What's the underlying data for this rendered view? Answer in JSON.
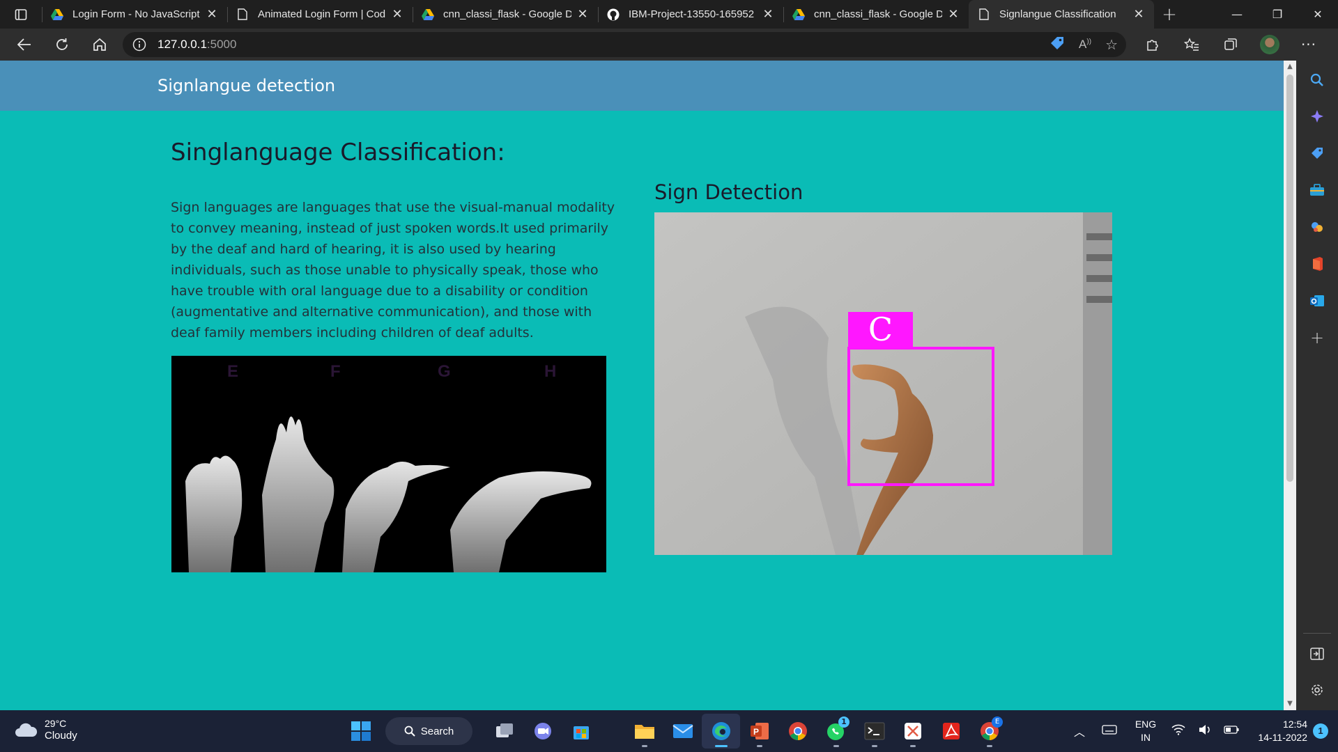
{
  "browser": {
    "tabs": [
      {
        "title": "Login Form - No JavaScript",
        "icon": "drive-icon"
      },
      {
        "title": "Animated Login Form | Cod",
        "icon": "page-icon"
      },
      {
        "title": "cnn_classi_flask - Google Dr",
        "icon": "drive-icon"
      },
      {
        "title": "IBM-Project-13550-165952",
        "icon": "github-icon"
      },
      {
        "title": "cnn_classi_flask - Google Dr",
        "icon": "drive-icon"
      },
      {
        "title": "Signlangue Classification",
        "icon": "page-icon",
        "active": true
      }
    ],
    "address": {
      "host": "127.0.0.1",
      "port": ":5000"
    }
  },
  "page": {
    "brand": "Signlangue detection",
    "heading": "Singlanguage Classification:",
    "description": "Sign languages are languages that use the visual-manual modality to convey meaning, instead of just spoken words.It used primarily by the deaf and hard of hearing, it is also used by hearing individuals, such as those unable to physically speak, those who have trouble with oral language due to a disability or condition (augmentative and alternative communication), and those with deaf family members including children of deaf adults.",
    "image_letters": [
      "E",
      "F",
      "G",
      "H"
    ],
    "detection_title": "Sign Detection",
    "prediction_label": "C",
    "accent_color": "#ff17ff",
    "background_color": "#0abcb6",
    "navbar_color": "#4a90b9"
  },
  "taskbar": {
    "weather_temp": "29°C",
    "weather_desc": "Cloudy",
    "search_label": "Search",
    "lang_top": "ENG",
    "lang_bottom": "IN",
    "time": "12:54",
    "date": "14-11-2022",
    "notification_count": "1",
    "whatsapp_badge": "1",
    "chrome_badge": "E"
  }
}
